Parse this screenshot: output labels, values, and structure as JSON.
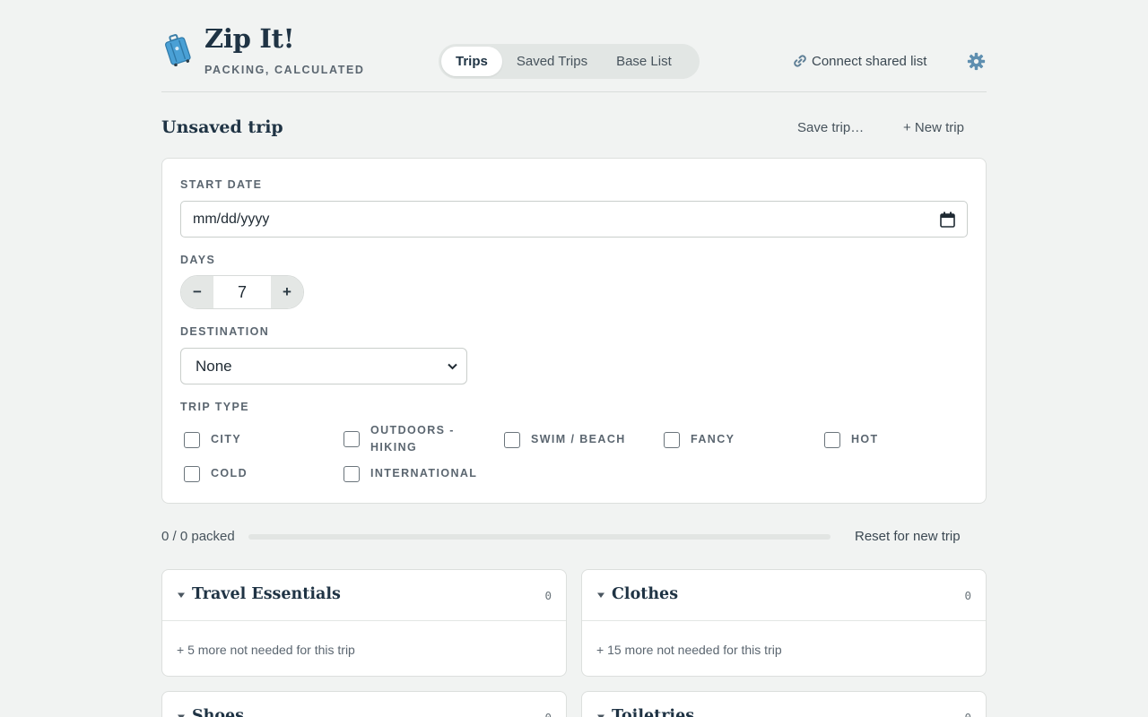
{
  "app": {
    "title": "Zip It!",
    "subtitle": "PACKING, CALCULATED",
    "logo_icon": "suitcase-icon"
  },
  "nav": {
    "tabs": [
      {
        "label": "Trips",
        "active": true
      },
      {
        "label": "Saved Trips",
        "active": false
      },
      {
        "label": "Base List",
        "active": false
      }
    ],
    "connect_label": "Connect shared list",
    "connect_icon": "link-icon",
    "settings_icon": "gear-icon"
  },
  "trip": {
    "title": "Unsaved trip",
    "save_label": "Save trip…",
    "new_label": "+ New trip"
  },
  "form": {
    "start_date": {
      "label": "START DATE",
      "placeholder": "mm/dd/yyyy"
    },
    "days": {
      "label": "DAYS",
      "value": "7",
      "decrement": "−",
      "increment": "+"
    },
    "destination": {
      "label": "DESTINATION",
      "selected": "None"
    },
    "trip_type": {
      "label": "TRIP TYPE",
      "options": [
        {
          "label": "CITY",
          "checked": false
        },
        {
          "label": "OUTDOORS - HIKING",
          "checked": false
        },
        {
          "label": "SWIM / BEACH",
          "checked": false
        },
        {
          "label": "FANCY",
          "checked": false
        },
        {
          "label": "HOT",
          "checked": false
        },
        {
          "label": "COLD",
          "checked": false
        },
        {
          "label": "INTERNATIONAL",
          "checked": false
        }
      ]
    }
  },
  "progress": {
    "text": "0 / 0 packed",
    "fraction": 0,
    "reset_label": "Reset for new trip"
  },
  "categories": [
    {
      "name": "Travel Essentials",
      "count": "0",
      "more": "+ 5 more not needed for this trip"
    },
    {
      "name": "Clothes",
      "count": "0",
      "more": "+ 15 more not needed for this trip"
    },
    {
      "name": "Shoes",
      "count": "0"
    },
    {
      "name": "Toiletries",
      "count": "0"
    }
  ],
  "colors": {
    "background": "#f1f3f2",
    "accent": "#3f6f8a",
    "heading": "#1f3344"
  }
}
